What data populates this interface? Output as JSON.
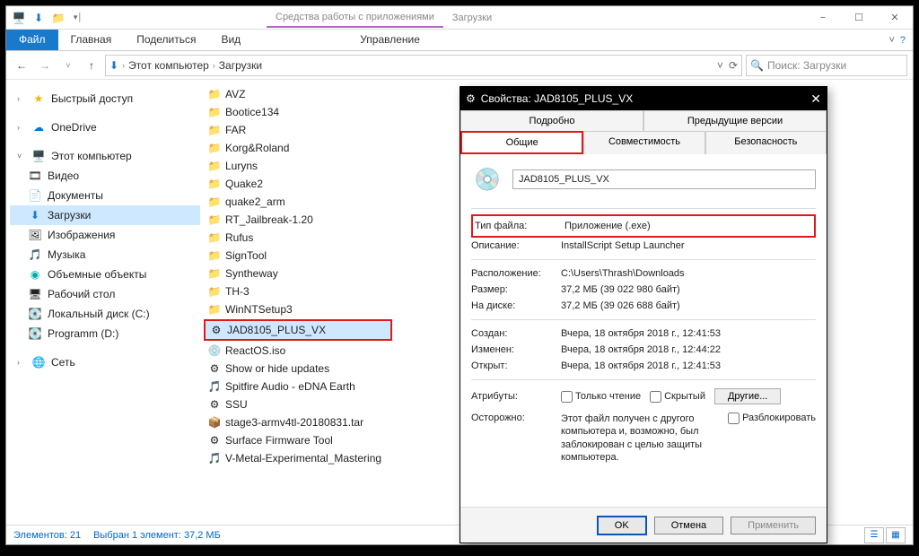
{
  "titlebar": {
    "contextual_tab": "Средства работы с приложениями",
    "tab2": "Загрузки"
  },
  "ribbon": {
    "file": "Файл",
    "tabs": [
      "Главная",
      "Поделиться",
      "Вид"
    ],
    "mgmt": "Управление"
  },
  "breadcrumb": {
    "root": "Этот компьютер",
    "folder": "Загрузки"
  },
  "search": {
    "placeholder": "Поиск: Загрузки"
  },
  "sidebar": {
    "quick": "Быстрый доступ",
    "onedrive": "OneDrive",
    "thispc": "Этот компьютер",
    "items": [
      "Видео",
      "Документы",
      "Загрузки",
      "Изображения",
      "Музыка",
      "Объемные объекты",
      "Рабочий стол",
      "Локальный диск (C:)",
      "Programm (D:)"
    ],
    "network": "Сеть"
  },
  "files": {
    "folders": [
      "AVZ",
      "Bootice134",
      "FAR",
      "Korg&Roland",
      "Luryns",
      "Quake2",
      "quake2_arm",
      "RT_Jailbreak-1.20",
      "Rufus",
      "SignTool",
      "Syntheway",
      "TH-3",
      "WinNTSetup3"
    ],
    "selected": "JAD8105_PLUS_VX",
    "other": [
      {
        "icon": "💿",
        "name": "ReactOS.iso"
      },
      {
        "icon": "⚙",
        "name": "Show or hide updates"
      },
      {
        "icon": "🎵",
        "name": "Spitfire Audio - eDNA Earth"
      },
      {
        "icon": "⚙",
        "name": "SSU"
      },
      {
        "icon": "📦",
        "name": "stage3-armv4tl-20180831.tar"
      },
      {
        "icon": "⚙",
        "name": "Surface Firmware Tool"
      },
      {
        "icon": "🎵",
        "name": "V-Metal-Experimental_Mastering"
      }
    ]
  },
  "status": {
    "count": "Элементов: 21",
    "sel": "Выбран 1 элемент: 37,2 МБ"
  },
  "props": {
    "title": "Свойства: JAD8105_PLUS_VX",
    "tabs_top": [
      "Подробно",
      "Предыдущие версии"
    ],
    "tabs_bottom": [
      "Общие",
      "Совместимость",
      "Безопасность"
    ],
    "filename": "JAD8105_PLUS_VX",
    "rows": {
      "type_k": "Тип файла:",
      "type_v": "Приложение (.exe)",
      "desc_k": "Описание:",
      "desc_v": "InstallScript Setup Launcher",
      "loc_k": "Расположение:",
      "loc_v": "C:\\Users\\Thrash\\Downloads",
      "size_k": "Размер:",
      "size_v": "37,2 МБ (39 022 980 байт)",
      "disk_k": "На диске:",
      "disk_v": "37,2 МБ (39 026 688 байт)",
      "created_k": "Создан:",
      "created_v": "Вчера, 18 октября 2018 г., 12:41:53",
      "modified_k": "Изменен:",
      "modified_v": "Вчера, 18 октября 2018 г., 12:44:22",
      "opened_k": "Открыт:",
      "opened_v": "Вчера, 18 октября 2018 г., 12:41:53",
      "attr_k": "Атрибуты:",
      "readonly": "Только чтение",
      "hidden": "Скрытый",
      "other": "Другие...",
      "warn_k": "Осторожно:",
      "warn_v": "Этот файл получен с другого компьютера и, возможно, был заблокирован с целью защиты компьютера.",
      "unblock": "Разблокировать"
    },
    "buttons": {
      "ok": "OK",
      "cancel": "Отмена",
      "apply": "Применить"
    }
  }
}
